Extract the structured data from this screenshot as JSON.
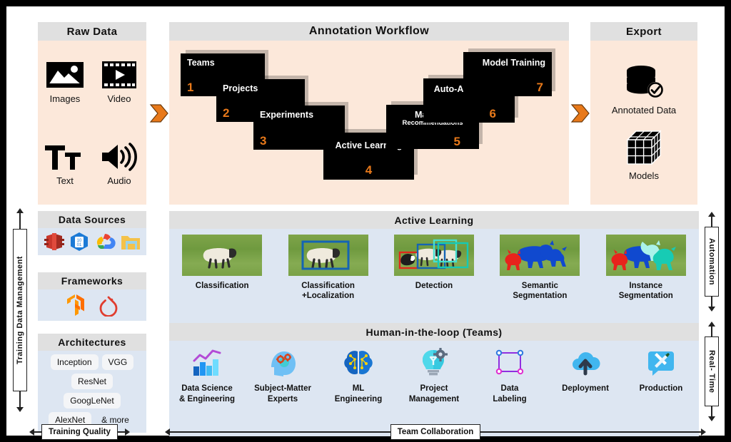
{
  "theme": {
    "page_bg": "#000000",
    "canvas_bg": "#ffffff",
    "header_bg": "#e0e0e0",
    "peach_bg": "#fce8da",
    "blue_bg": "#dde6f2",
    "accent_orange": "#e8791a",
    "card_bg": "#000000"
  },
  "raw_data": {
    "title": "Raw Data",
    "items": [
      {
        "label": "Images",
        "icon": "image-icon"
      },
      {
        "label": "Video",
        "icon": "video-film-icon"
      },
      {
        "label": "Text",
        "icon": "text-tt-icon"
      },
      {
        "label": "Audio",
        "icon": "speaker-icon"
      }
    ]
  },
  "workflow": {
    "title": "Annotation Workflow",
    "cards": [
      {
        "number": "1",
        "title": "Teams",
        "subtitle": ""
      },
      {
        "number": "2",
        "title": "Projects",
        "subtitle": ""
      },
      {
        "number": "3",
        "title": "Experiments",
        "subtitle": ""
      },
      {
        "number": "4",
        "title": "Active Learning",
        "subtitle": ""
      },
      {
        "number": "5",
        "title": "Machine",
        "subtitle": "Recommendations"
      },
      {
        "number": "6",
        "title": "Auto-Annotation",
        "subtitle": ""
      },
      {
        "number": "7",
        "title": "Model Training",
        "subtitle": ""
      }
    ]
  },
  "export": {
    "title": "Export",
    "items": [
      {
        "label": "Annotated Data",
        "icon": "database-check-icon"
      },
      {
        "label": "Models",
        "icon": "cube-blocks-icon"
      }
    ]
  },
  "data_sources": {
    "title": "Data Sources",
    "icons": [
      "aws-s3-icon",
      "azure-blob-storage-icon",
      "google-cloud-icon",
      "local-folder-icon"
    ]
  },
  "frameworks": {
    "title": "Frameworks",
    "icons": [
      "tensorflow-icon",
      "pytorch-icon"
    ]
  },
  "architectures": {
    "title": "Architectures",
    "chips": [
      "Inception",
      "VGG",
      "ResNet",
      "GoogLeNet",
      "AlexNet",
      "& more"
    ]
  },
  "active_learning": {
    "title": "Active Learning",
    "items": [
      {
        "label": "Classification",
        "mode": "none"
      },
      {
        "label": "Classification\n+Localization",
        "mode": "box-single"
      },
      {
        "label": "Detection",
        "mode": "box-multi"
      },
      {
        "label": "Semantic\nSegmentation",
        "mode": "semantic"
      },
      {
        "label": "Instance\nSegmentation",
        "mode": "instance"
      }
    ]
  },
  "human_in_the_loop": {
    "title": "Human-in-the-loop (Teams)",
    "items": [
      {
        "label": "Data Science\n& Engineering",
        "icon": "bar-chart-trend-icon"
      },
      {
        "label": "Subject-Matter\nExperts",
        "icon": "head-gears-icon"
      },
      {
        "label": "ML\nEngineering",
        "icon": "brain-circuit-icon"
      },
      {
        "label": "Project\nManagement",
        "icon": "lightbulb-gear-icon"
      },
      {
        "label": "Data\nLabeling",
        "icon": "bounding-box-icon"
      },
      {
        "label": "Deployment",
        "icon": "cloud-upload-icon"
      },
      {
        "label": "Production",
        "icon": "tools-wrench-screwdriver-icon"
      }
    ]
  },
  "axes": {
    "left_vertical": "Training Data Management",
    "right_vertical_top": "Automation",
    "right_vertical_bottom": "Real- Time",
    "bottom_left": "Training Quality",
    "bottom_right": "Team Collaboration"
  }
}
